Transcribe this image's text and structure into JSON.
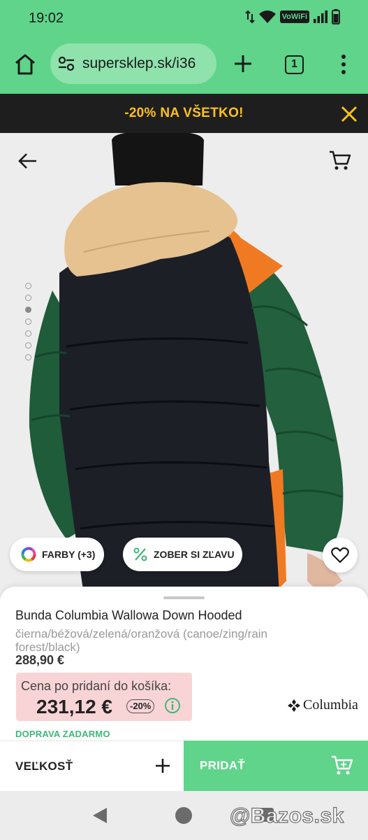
{
  "status_bar": {
    "time": "19:02",
    "volte_label": "VoWiFi",
    "icons": [
      "data-arrows-icon",
      "wifi-icon",
      "vowifi-badge",
      "signal-icon",
      "battery-icon"
    ]
  },
  "browser": {
    "url": "supersklep.sk/i36",
    "tab_count": "1",
    "icons": [
      "home-icon",
      "tune-icon",
      "plus-icon",
      "tab-count",
      "more-vert-icon"
    ]
  },
  "promo": {
    "text": "-20% NA VŠETKO!",
    "color": "#ffc21a"
  },
  "hero": {
    "carousel_dot_count": 7,
    "active_dot_index": 2,
    "chips": {
      "colors_label": "FARBY (+3)",
      "discount_label": "ZOBER SI ZĽAVU"
    }
  },
  "product": {
    "title": "Bunda Columbia Wallowa Down Hooded",
    "variant": "čierna/béžová/zelená/oranžová (canoe/zing/rain forest/black)",
    "price": "288,90 €",
    "cart_price_label": "Cena po pridaní do košíka:",
    "cart_price": "231,12 €",
    "discount_badge": "-20%",
    "brand": "Columbia",
    "shipping": "DOPRAVA ZADARMO"
  },
  "actions": {
    "size_label": "VEĽKOSŤ",
    "add_label": "PRIDAŤ"
  },
  "watermark": "@Bazos.sk",
  "colors": {
    "accent_green": "#5fd48a",
    "dark": "#1e1e1e",
    "price_highlight": "#f9d4d6",
    "shipping_green": "#3cb878"
  }
}
